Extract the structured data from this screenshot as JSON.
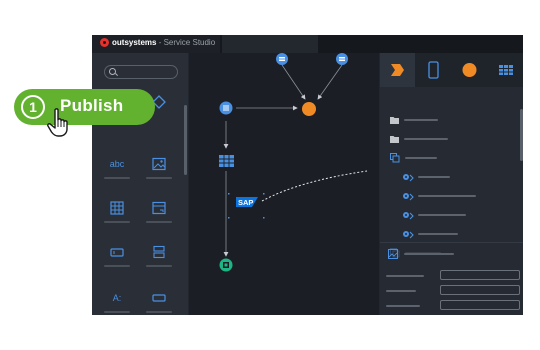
{
  "window": {
    "app_brand": "outsystems",
    "app_separator": " - ",
    "app_name": "Service Studio"
  },
  "callout": {
    "number": "1",
    "label": "Publish"
  },
  "toolbox": {
    "items": [
      {
        "name": "text",
        "glyph": "abc"
      },
      {
        "name": "image",
        "glyph": ""
      },
      {
        "name": "table",
        "glyph": ""
      },
      {
        "name": "container",
        "glyph": ""
      },
      {
        "name": "input",
        "glyph": ""
      },
      {
        "name": "list",
        "glyph": ""
      },
      {
        "name": "label",
        "glyph": "A:"
      },
      {
        "name": "button",
        "glyph": ""
      }
    ]
  },
  "canvas": {
    "nodes": [
      "start",
      "aggregate",
      "sap",
      "end",
      "assign",
      "merge"
    ],
    "integration_label": "SAP"
  },
  "colors": {
    "accent_blue": "#4a90e2",
    "accent_orange": "#f08a24",
    "accent_green": "#62b22f",
    "end_green": "#1db584",
    "brand_red": "#e5322d"
  }
}
